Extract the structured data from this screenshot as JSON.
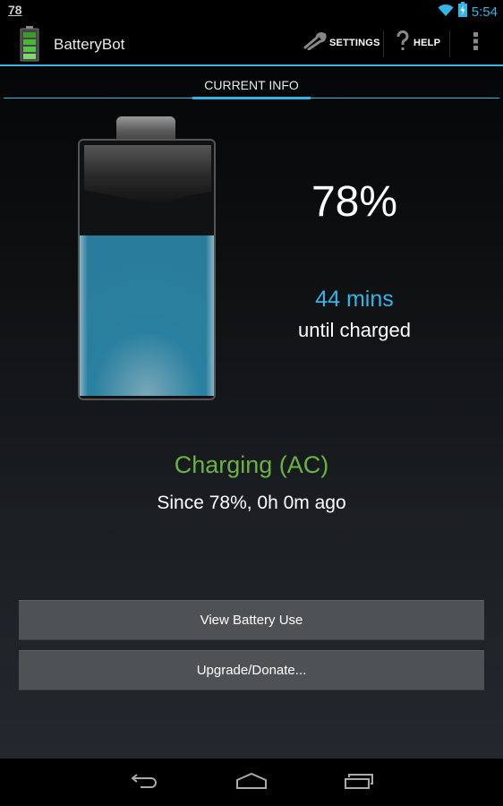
{
  "status_bar": {
    "notification_text": "78",
    "time": "5:54",
    "icons": [
      "wifi-icon",
      "battery-charging-icon"
    ]
  },
  "action_bar": {
    "app_icon": "battery-icon",
    "title": "BatteryBot",
    "actions": [
      {
        "icon": "wrench-icon",
        "label": "SETTINGS"
      },
      {
        "icon": "question-icon",
        "label": "HELP"
      },
      {
        "icon": "overflow-menu-icon",
        "label": ""
      }
    ]
  },
  "tabs": [
    {
      "label": "CURRENT INFO",
      "active": true
    }
  ],
  "battery": {
    "level_percent": 78,
    "level_text": "78%",
    "time_remaining": "44 mins",
    "time_remaining_label": "until charged",
    "state": "Charging (AC)",
    "since_text": "Since 78%, 0h 0m ago"
  },
  "buttons": {
    "view_battery_use": "View Battery Use",
    "upgrade_donate": "Upgrade/Donate..."
  },
  "nav_bar": {
    "icons": [
      "back-icon",
      "home-icon",
      "recent-apps-icon"
    ]
  },
  "colors": {
    "accent": "#33b5e5",
    "charging_green": "#6ab343",
    "button_bg": "#4f5255"
  }
}
